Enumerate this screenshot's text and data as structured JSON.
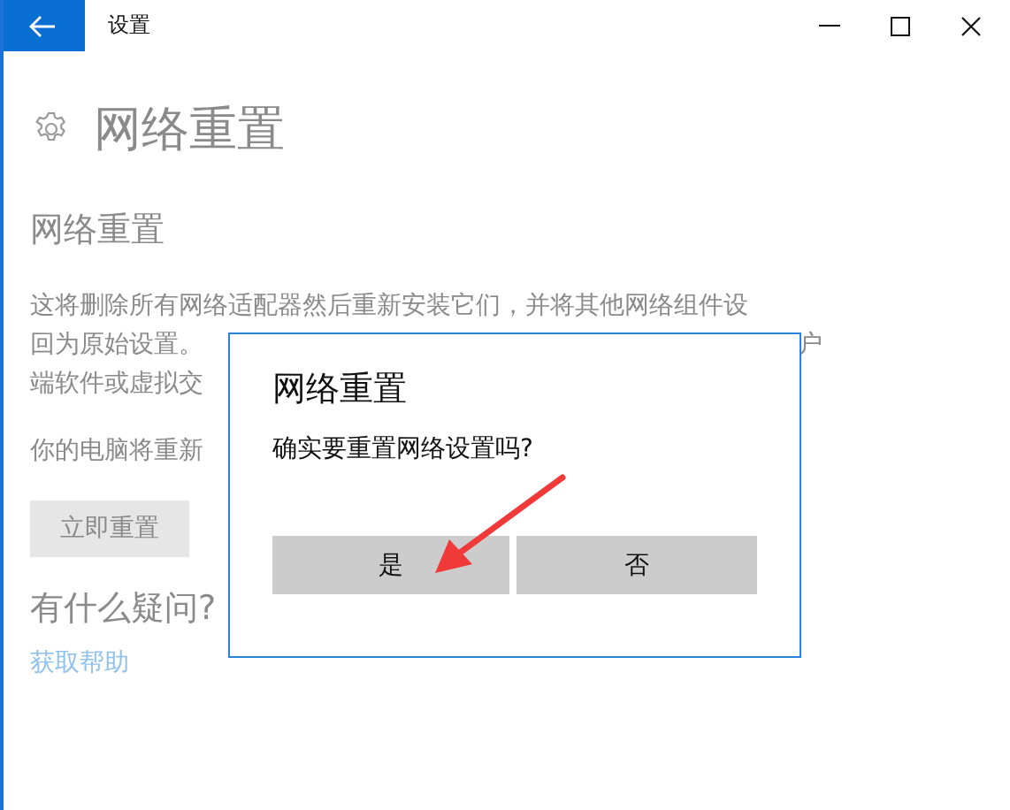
{
  "window": {
    "title": "设置"
  },
  "page": {
    "title": "网络重置"
  },
  "section": {
    "heading": "网络重置",
    "lines": [
      {
        "left": "这将删除所有网络适配器然后重新安装它们，并将其他网络组件设"
      },
      {
        "left": "回为原始设置。",
        "right": "户"
      },
      {
        "left": "端软件或虚拟交"
      }
    ],
    "notice": "你的电脑将重新",
    "reset_button": "立即重置"
  },
  "help": {
    "heading": "有什么疑问?",
    "link": "获取帮助"
  },
  "dialog": {
    "title": "网络重置",
    "message": "确实要重置网络设置吗?",
    "buttons": [
      {
        "label": "是"
      },
      {
        "label": "否"
      }
    ]
  }
}
